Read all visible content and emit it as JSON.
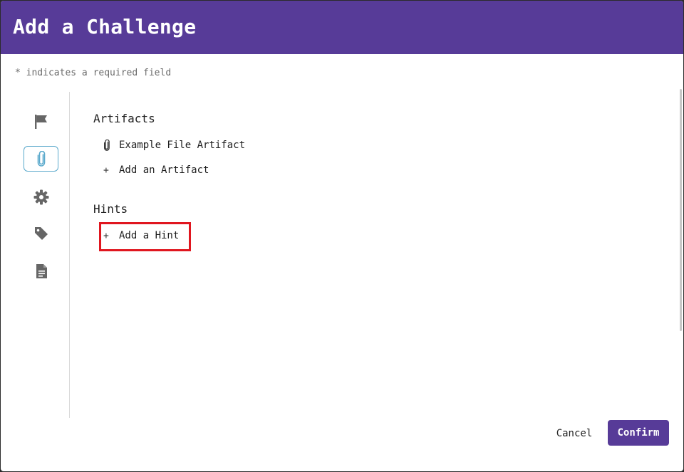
{
  "header": {
    "title": "Add a Challenge"
  },
  "required_note": "* indicates a required field",
  "sidebar": {
    "items": [
      {
        "icon": "flag-icon",
        "active": false
      },
      {
        "icon": "paperclip-icon",
        "active": true
      },
      {
        "icon": "gear-icon",
        "active": false
      },
      {
        "icon": "tag-icon",
        "active": false
      },
      {
        "icon": "document-icon",
        "active": false
      }
    ]
  },
  "artifacts": {
    "title": "Artifacts",
    "items": [
      {
        "label": "Example File Artifact",
        "icon": "paperclip-icon"
      }
    ],
    "add_label": "Add an Artifact",
    "add_glyph": "+"
  },
  "hints": {
    "title": "Hints",
    "add_label": "Add a Hint",
    "add_glyph": "+"
  },
  "footer": {
    "cancel_label": "Cancel",
    "confirm_label": "Confirm"
  },
  "colors": {
    "brand": "#573b98",
    "active_outline": "#5aa9cc",
    "highlight": "#e0161f"
  }
}
